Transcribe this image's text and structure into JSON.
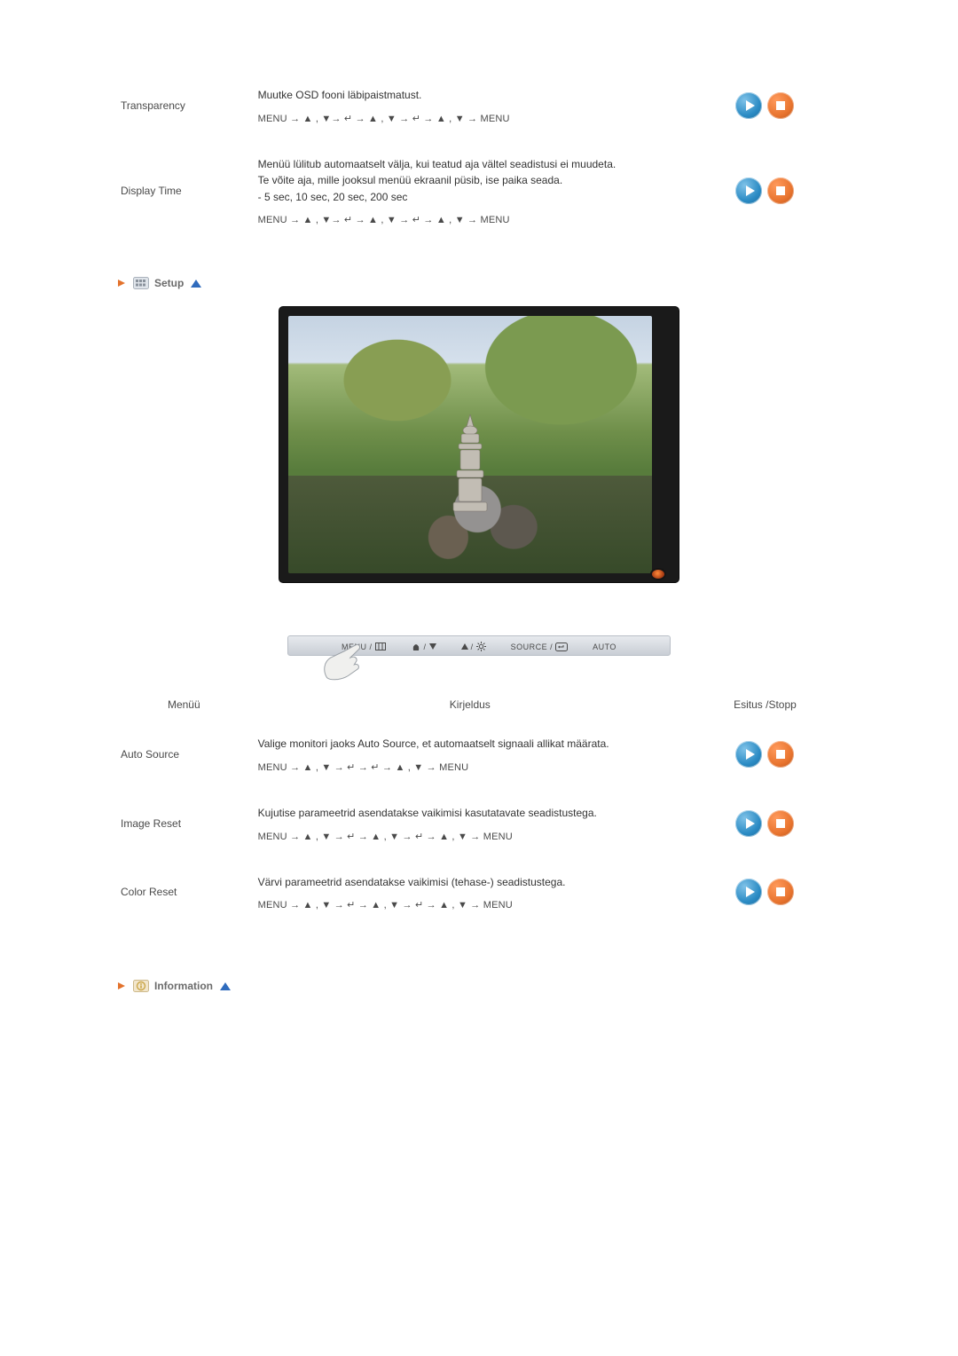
{
  "osd_rows": [
    {
      "name": "Transparency",
      "desc": "Muutke OSD fooni läbipaistmatust.",
      "path": "MENU → ▲ , ▼→ ↵ → ▲ , ▼ → ↵ → ▲ , ▼ → MENU"
    },
    {
      "name": "Display Time",
      "desc": "Menüü lülitub automaatselt välja, kui teatud aja vältel seadistusi ei muudeta.\nTe võite aja, mille jooksul menüü ekraanil püsib, ise paika seada.\n- 5 sec, 10 sec, 20 sec, 200 sec",
      "path": "MENU → ▲ , ▼→ ↵ → ▲ , ▼ → ↵ → ▲ , ▼ → MENU"
    }
  ],
  "section_setup": "Setup",
  "button_bar": {
    "menu": "MENU /",
    "mid": "/",
    "source": "SOURCE /",
    "auto": "AUTO"
  },
  "setup_headers": {
    "menu": "Menüü",
    "desc": "Kirjeldus",
    "play": "Esitus /Stopp"
  },
  "setup_rows": [
    {
      "name": "Auto Source",
      "desc": "Valige monitori jaoks Auto Source, et automaatselt signaali allikat määrata.",
      "path": "MENU → ▲ , ▼ → ↵ → ↵ → ▲ , ▼ → MENU"
    },
    {
      "name": "Image Reset",
      "desc": "Kujutise parameetrid asendatakse vaikimisi kasutatavate seadistustega.",
      "path": "MENU → ▲ , ▼ → ↵ → ▲ , ▼ → ↵ → ▲ , ▼ → MENU"
    },
    {
      "name": "Color Reset",
      "desc": "Värvi parameetrid asendatakse vaikimisi (tehase-) seadistustega.",
      "path": "MENU → ▲ , ▼ → ↵ → ▲ , ▼ → ↵ → ▲ , ▼ → MENU"
    }
  ],
  "section_info": "Information"
}
